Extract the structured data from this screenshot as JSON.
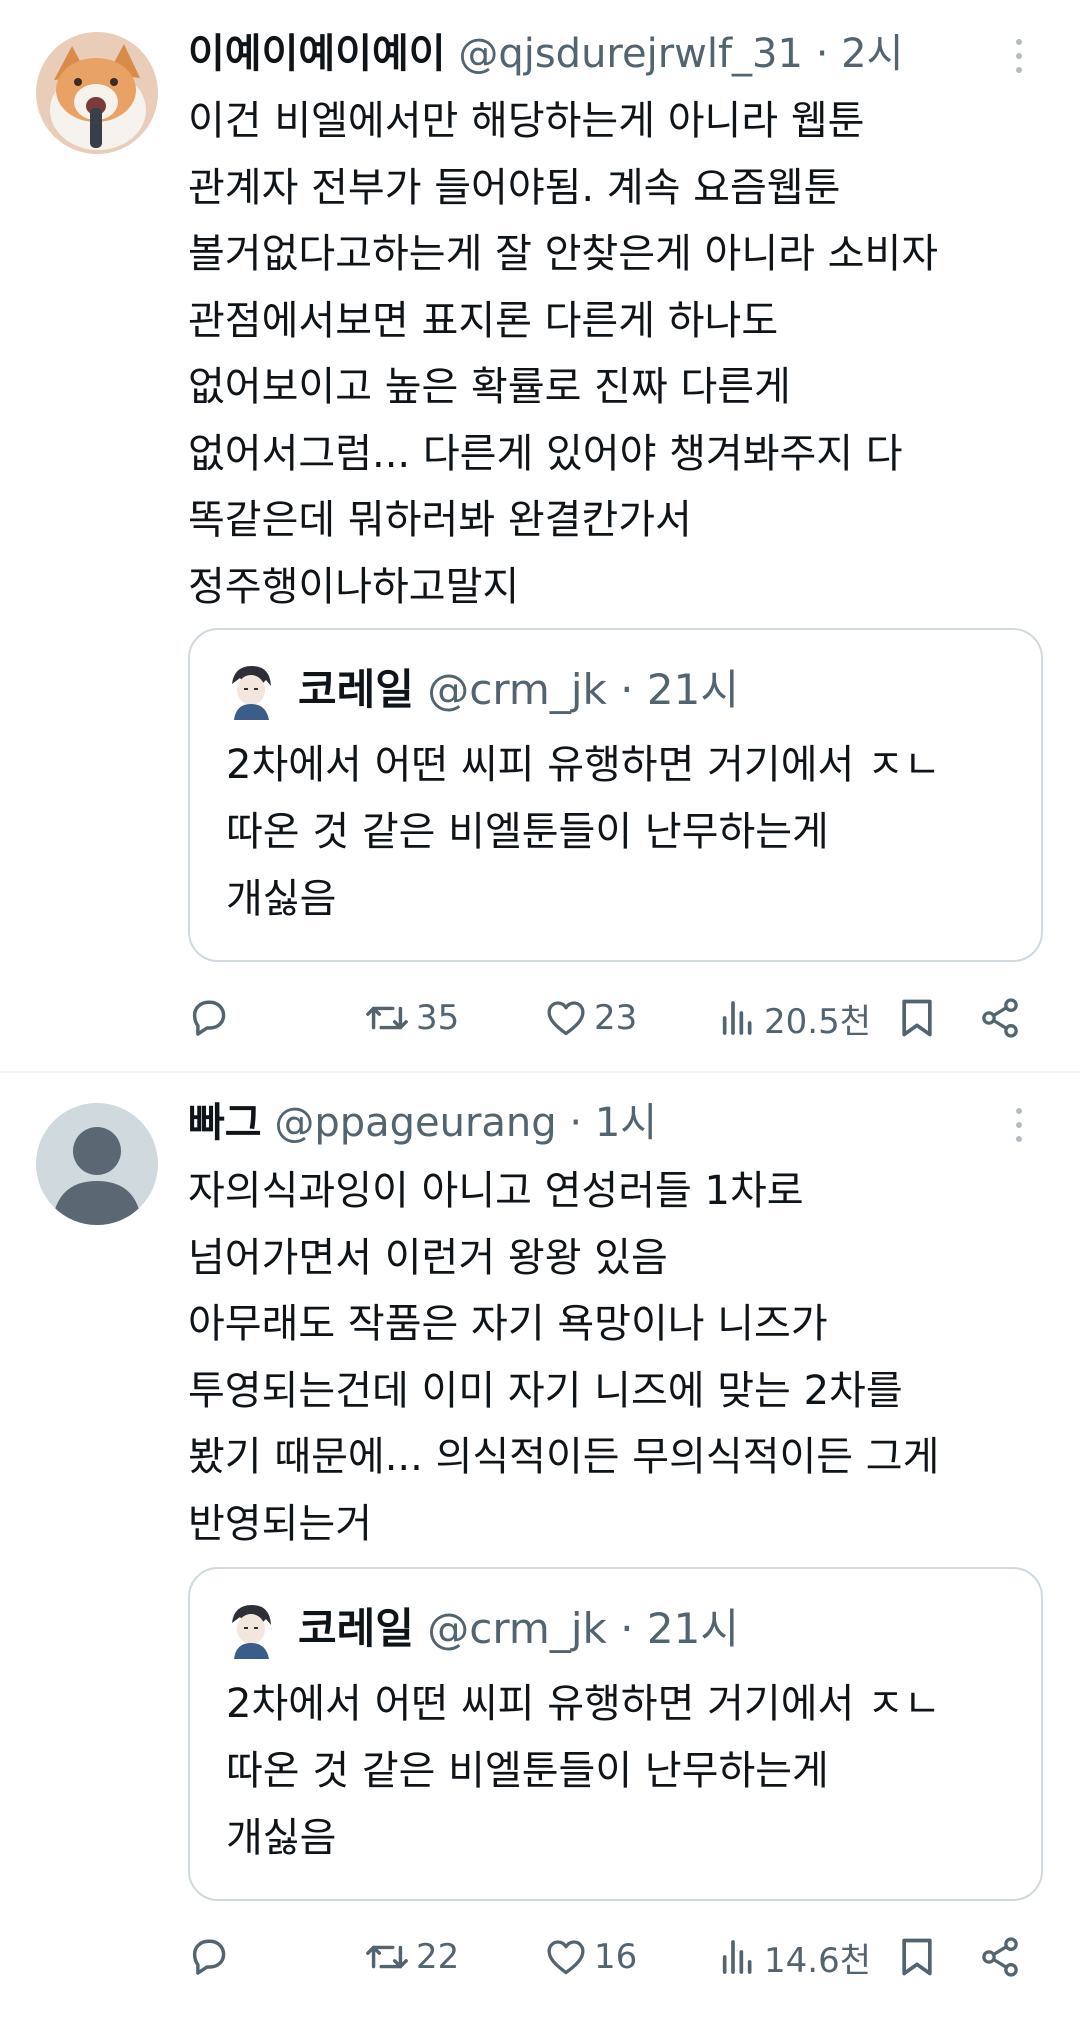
{
  "tweets": [
    {
      "display_name": "이예이예이예이",
      "handle": "@qjsdurejrwlf_31",
      "time": "2시",
      "body": [
        "이건 비엘에서만 해당하는게 아니라 웹툰",
        "관계자 전부가 들어야됨. 계속 요즘웹툰",
        "볼거없다고하는게 잘 안찾은게 아니라 소비자",
        "관점에서보면 표지론 다른게 하나도",
        "없어보이고 높은 확률로 진짜 다른게",
        "없어서그럼... 다른게 있어야 챙겨봐주지 다",
        "똑같은데 뭐하러봐 완결칸가서",
        "정주행이나하고말지"
      ],
      "quote": {
        "display_name": "코레일",
        "handle": "@crm_jk",
        "time": "21시",
        "body": [
          "2차에서 어떤 씨피 유행하면 거기에서 ㅈㄴ",
          "따온 것 같은 비엘툰들이 난무하는게",
          "개싫음"
        ]
      },
      "stats": {
        "retweets": "35",
        "likes": "23",
        "views": "20.5천"
      }
    },
    {
      "display_name": "빠그",
      "handle": "@ppageurang",
      "time": "1시",
      "body": [
        "자의식과잉이 아니고 연성러들 1차로",
        "넘어가면서 이런거 왕왕 있음",
        "아무래도 작품은 자기 욕망이나 니즈가",
        "투영되는건데 이미 자기 니즈에 맞는 2차를",
        "봤기 때문에... 의식적이든 무의식적이든 그게",
        "반영되는거"
      ],
      "quote": {
        "display_name": "코레일",
        "handle": "@crm_jk",
        "time": "21시",
        "body": [
          "2차에서 어떤 씨피 유행하면 거기에서 ㅈㄴ",
          "따온 것 같은 비엘툰들이 난무하는게",
          "개싫음"
        ]
      },
      "stats": {
        "retweets": "22",
        "likes": "16",
        "views": "14.6천"
      }
    }
  ],
  "separator": "·",
  "colors": {
    "text": "#0f1419",
    "secondary": "#536471",
    "border": "#cfd9de",
    "divider": "#eff3f4"
  },
  "icons": [
    "reply-icon",
    "retweet-icon",
    "like-icon",
    "views-icon",
    "bookmark-icon",
    "share-icon",
    "more-icon"
  ]
}
